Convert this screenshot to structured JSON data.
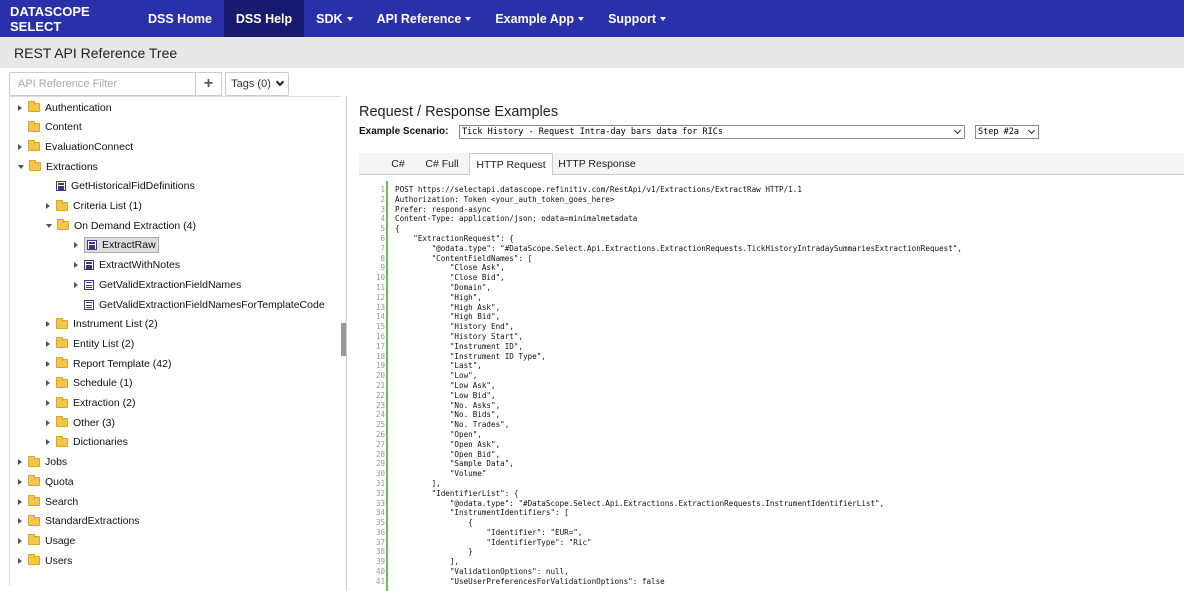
{
  "nav": {
    "brand": "DATASCOPE SELECT",
    "items": [
      {
        "label": "DSS Home",
        "caret": false,
        "active": false
      },
      {
        "label": "DSS Help",
        "caret": false,
        "active": true
      },
      {
        "label": "SDK",
        "caret": true,
        "active": false
      },
      {
        "label": "API Reference",
        "caret": true,
        "active": false
      },
      {
        "label": "Example App",
        "caret": true,
        "active": false
      },
      {
        "label": "Support",
        "caret": true,
        "active": false
      }
    ]
  },
  "page_title": "REST API Reference Tree",
  "filter": {
    "placeholder": "API Reference Filter",
    "add_label": "+",
    "tags_label": "Tags (0)"
  },
  "tree": [
    {
      "label": "Authentication",
      "type": "folder",
      "arrow": "right",
      "level": 0
    },
    {
      "label": "Content",
      "type": "folder",
      "arrow": "none",
      "level": 0
    },
    {
      "label": "EvaluationConnect",
      "type": "folder",
      "arrow": "right",
      "level": 0
    },
    {
      "label": "Extractions",
      "type": "folder",
      "arrow": "down",
      "level": 0
    },
    {
      "label": "GetHistoricalFidDefinitions",
      "type": "method",
      "arrow": "none",
      "level": 1
    },
    {
      "label": "Criteria List (1)",
      "type": "folder",
      "arrow": "right",
      "level": 1
    },
    {
      "label": "On Demand Extraction (4)",
      "type": "folder",
      "arrow": "down",
      "level": 1
    },
    {
      "label": "ExtractRaw",
      "type": "method",
      "arrow": "right",
      "level": 2,
      "selected": true
    },
    {
      "label": "ExtractWithNotes",
      "type": "method",
      "arrow": "right",
      "level": 2
    },
    {
      "label": "GetValidExtractionFieldNames",
      "type": "method",
      "arrow": "right",
      "level": 2
    },
    {
      "label": "GetValidExtractionFieldNamesForTemplateCode",
      "type": "method",
      "arrow": "none",
      "level": 2
    },
    {
      "label": "Instrument List (2)",
      "type": "folder",
      "arrow": "right",
      "level": 1
    },
    {
      "label": "Entity List (2)",
      "type": "folder",
      "arrow": "right",
      "level": 1
    },
    {
      "label": "Report Template (42)",
      "type": "folder",
      "arrow": "right",
      "level": 1
    },
    {
      "label": "Schedule (1)",
      "type": "folder",
      "arrow": "right",
      "level": 1
    },
    {
      "label": "Extraction (2)",
      "type": "folder",
      "arrow": "right",
      "level": 1
    },
    {
      "label": "Other (3)",
      "type": "folder",
      "arrow": "right",
      "level": 1
    },
    {
      "label": "Dictionaries",
      "type": "folder",
      "arrow": "right",
      "level": 1
    },
    {
      "label": "Jobs",
      "type": "folder",
      "arrow": "right",
      "level": 0
    },
    {
      "label": "Quota",
      "type": "folder",
      "arrow": "right",
      "level": 0
    },
    {
      "label": "Search",
      "type": "folder",
      "arrow": "right",
      "level": 0
    },
    {
      "label": "StandardExtractions",
      "type": "folder",
      "arrow": "right",
      "level": 0
    },
    {
      "label": "Usage",
      "type": "folder",
      "arrow": "right",
      "level": 0
    },
    {
      "label": "Users",
      "type": "folder",
      "arrow": "right",
      "level": 0
    }
  ],
  "examples": {
    "title": "Request / Response Examples",
    "scenario_label": "Example Scenario:",
    "scenario_value": "Tick History - Request Intra-day bars data for RICs",
    "step_value": "Step #2a",
    "tabs": [
      {
        "label": "C#",
        "active": false
      },
      {
        "label": "C# Full",
        "active": false
      },
      {
        "label": "HTTP Request",
        "active": true
      },
      {
        "label": "HTTP Response",
        "active": false
      }
    ]
  },
  "code_lines": [
    "POST https://selectapi.datascope.refinitiv.com/RestApi/v1/Extractions/ExtractRaw HTTP/1.1",
    "Authorization: Token <your_auth_token_goes_here>",
    "Prefer: respond-async",
    "Content-Type: application/json; odata=minimalmetadata",
    "{",
    "    \"ExtractionRequest\": {",
    "        \"@odata.type\": \"#DataScope.Select.Api.Extractions.ExtractionRequests.TickHistoryIntradaySummariesExtractionRequest\",",
    "        \"ContentFieldNames\": [",
    "            \"Close Ask\",",
    "            \"Close Bid\",",
    "            \"Domain\",",
    "            \"High\",",
    "            \"High Ask\",",
    "            \"High Bid\",",
    "            \"History End\",",
    "            \"History Start\",",
    "            \"Instrument ID\",",
    "            \"Instrument ID Type\",",
    "            \"Last\",",
    "            \"Low\",",
    "            \"Low Ask\",",
    "            \"Low Bid\",",
    "            \"No. Asks\",",
    "            \"No. Bids\",",
    "            \"No. Trades\",",
    "            \"Open\",",
    "            \"Open Ask\",",
    "            \"Open Bid\",",
    "            \"Sample Data\",",
    "            \"Volume\"",
    "        ],",
    "        \"IdentifierList\": {",
    "            \"@odata.type\": \"#DataScope.Select.Api.Extractions.ExtractionRequests.InstrumentIdentifierList\",",
    "            \"InstrumentIdentifiers\": [",
    "                {",
    "                    \"Identifier\": \"EUR=\",",
    "                    \"IdentifierType\": \"Ric\"",
    "                }",
    "            ],",
    "            \"ValidationOptions\": null,",
    "            \"UseUserPreferencesForValidationOptions\": false"
  ]
}
